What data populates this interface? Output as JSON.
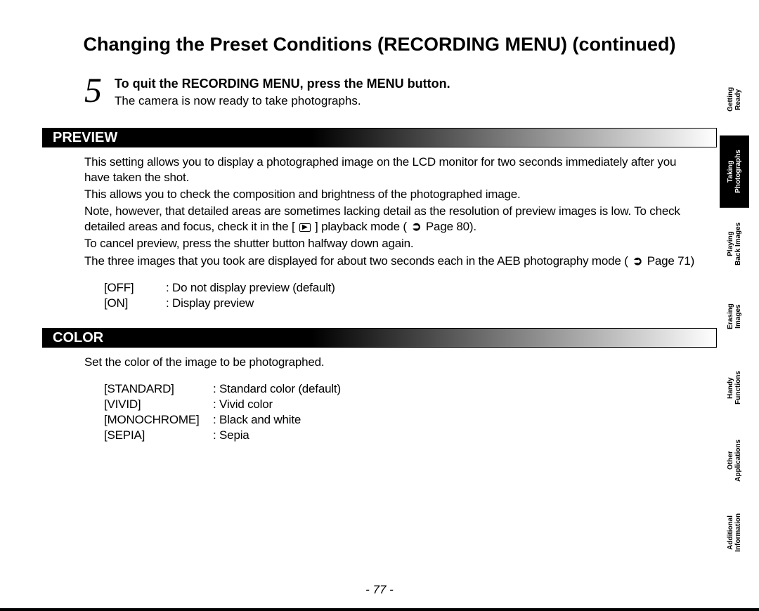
{
  "title": "Changing the Preset Conditions (RECORDING MENU) (continued)",
  "step": {
    "number": "5",
    "heading": "To quit the RECORDING MENU, press the MENU button.",
    "sub": "The camera is now ready to take photographs."
  },
  "preview": {
    "heading": "PREVIEW",
    "para1": "This setting allows you to display a photographed image on the LCD monitor for two seconds immediately after you have taken the shot.",
    "para2": "This allows you to check the composition and brightness of the photographed image.",
    "para3a": "Note, however, that detailed areas are sometimes lacking detail as the resolution of preview images is low. To check detailed areas and focus, check it in the [ ",
    "para3b": " ] playback mode (",
    "para3c": " Page 80).",
    "para4": "To cancel preview, press the shutter button halfway down again.",
    "para5a": "The three images that you took are displayed for about two seconds each in the AEB photography mode (",
    "para5b": " Page 71)",
    "options": [
      {
        "key": "[OFF]",
        "val": ": Do not display preview (default)"
      },
      {
        "key": "[ON]",
        "val": ": Display preview"
      }
    ]
  },
  "color": {
    "heading": "COLOR",
    "intro": "Set the color of the image to be photographed.",
    "options": [
      {
        "key": "[STANDARD]",
        "val": ": Standard color (default)"
      },
      {
        "key": "[VIVID]",
        "val": ": Vivid color"
      },
      {
        "key": "[MONOCHROME]",
        "val": ": Black and white"
      },
      {
        "key": "[SEPIA]",
        "val": ": Sepia"
      }
    ]
  },
  "pageNumber": "- 77 -",
  "tabs": [
    {
      "label": "Getting\nReady",
      "active": false
    },
    {
      "label": "Taking\nPhotographs",
      "active": true
    },
    {
      "label": "Playing\nBack Images",
      "active": false
    },
    {
      "label": "Erasing\nImages",
      "active": false
    },
    {
      "label": "Handy\nFunctions",
      "active": false
    },
    {
      "label": "Other\nApplications",
      "active": false
    },
    {
      "label": "Additional\nInformation",
      "active": false
    }
  ],
  "glyphs": {
    "playback": "▶",
    "refresh": "➲"
  }
}
